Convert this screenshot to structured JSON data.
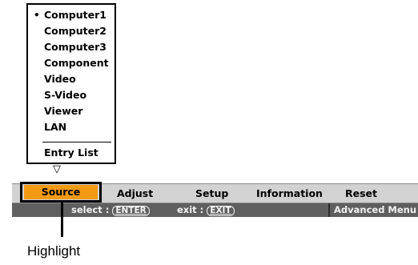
{
  "source_dropdown": {
    "selected_bullet": "•",
    "items": [
      "Computer1",
      "Computer2",
      "Computer3",
      "Component",
      "Video",
      "S-Video",
      "Viewer",
      "LAN"
    ],
    "entry_list_label": "Entry List",
    "pointer_glyph": "▽"
  },
  "menubar": {
    "tabs": [
      "Source",
      "Adjust",
      "Setup",
      "Information",
      "Reset"
    ],
    "active_tab": "Source",
    "active_color": "#f29a12",
    "bar_color": "#d2d2d2"
  },
  "statusbar": {
    "select_label": "select :",
    "select_key": "ENTER",
    "exit_label": "exit :",
    "exit_key": "EXIT",
    "advanced_menu": "Advanced Menu",
    "bar_color": "#5f5f5f"
  },
  "callout": {
    "label": "Highlight"
  }
}
